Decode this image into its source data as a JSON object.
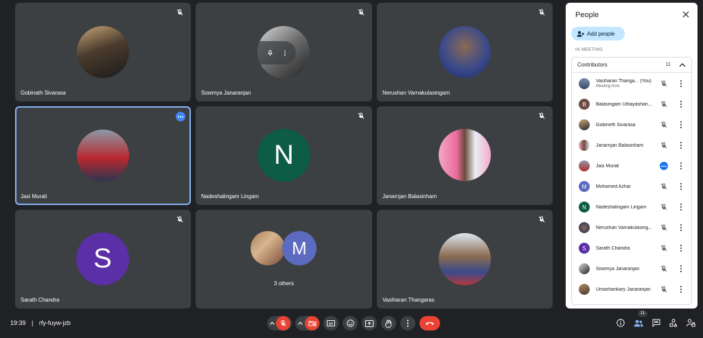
{
  "tiles": [
    {
      "name": "Gobinath Sivarasa"
    },
    {
      "name": "Sowmya Janaranjan"
    },
    {
      "name": "Nerushan Varnakulasingam"
    },
    {
      "name": "Jasi Murali"
    },
    {
      "name": "Nadeshalingam Lingam",
      "letter": "N"
    },
    {
      "name": "Janarnjan Balasinham"
    },
    {
      "name": "Sarath Chandra",
      "letter": "S"
    },
    {
      "others_label": "3 others",
      "letter": "M"
    },
    {
      "name": "Vasiharan Thangaras"
    }
  ],
  "panel": {
    "title": "People",
    "add_people": "Add people",
    "section": "IN MEETING",
    "group": "Contributors",
    "count": "11",
    "people": [
      {
        "name": "Vasiharan Thanga...  (You)",
        "sub": "Meeting host"
      },
      {
        "name": "Balasingam Uthayashan...",
        "letter": "B"
      },
      {
        "name": "Gobineth Sivarasa"
      },
      {
        "name": "Janarnjan Balasinham"
      },
      {
        "name": "Jasi Murali"
      },
      {
        "name": "Mohamed Azhar",
        "letter": "M"
      },
      {
        "name": "Nadeshalingam Lingam",
        "letter": "N"
      },
      {
        "name": "Nerushan Varnakulasing..."
      },
      {
        "name": "Sarath Chandra",
        "letter": "S"
      },
      {
        "name": "Sowmya Janaranjan"
      },
      {
        "name": "Umashankary Janaranjan"
      }
    ]
  },
  "bottom": {
    "time": "19:39",
    "separator": "|",
    "meeting_code": "rfy-fuyw-jzb",
    "participants_badge": "11"
  },
  "colors": {
    "background": "#202124",
    "tile": "#3c4043",
    "accent": "#8ab4f8",
    "danger": "#ea4335",
    "add_people_bg": "#c2e7ff",
    "avatar_n": "#0d5c45",
    "avatar_s": "#5b2fa8",
    "avatar_m": "#5c6bc0",
    "avatar_b": "#6d4c41"
  },
  "icons": [
    "mic-off-icon",
    "more-vert-icon",
    "close-icon",
    "add-person-icon",
    "chevron-up-icon",
    "camera-off-icon",
    "captions-icon",
    "emoji-icon",
    "present-icon",
    "hand-icon",
    "end-call-icon",
    "info-icon",
    "people-icon",
    "chat-icon",
    "activities-icon",
    "lock-person-icon"
  ]
}
